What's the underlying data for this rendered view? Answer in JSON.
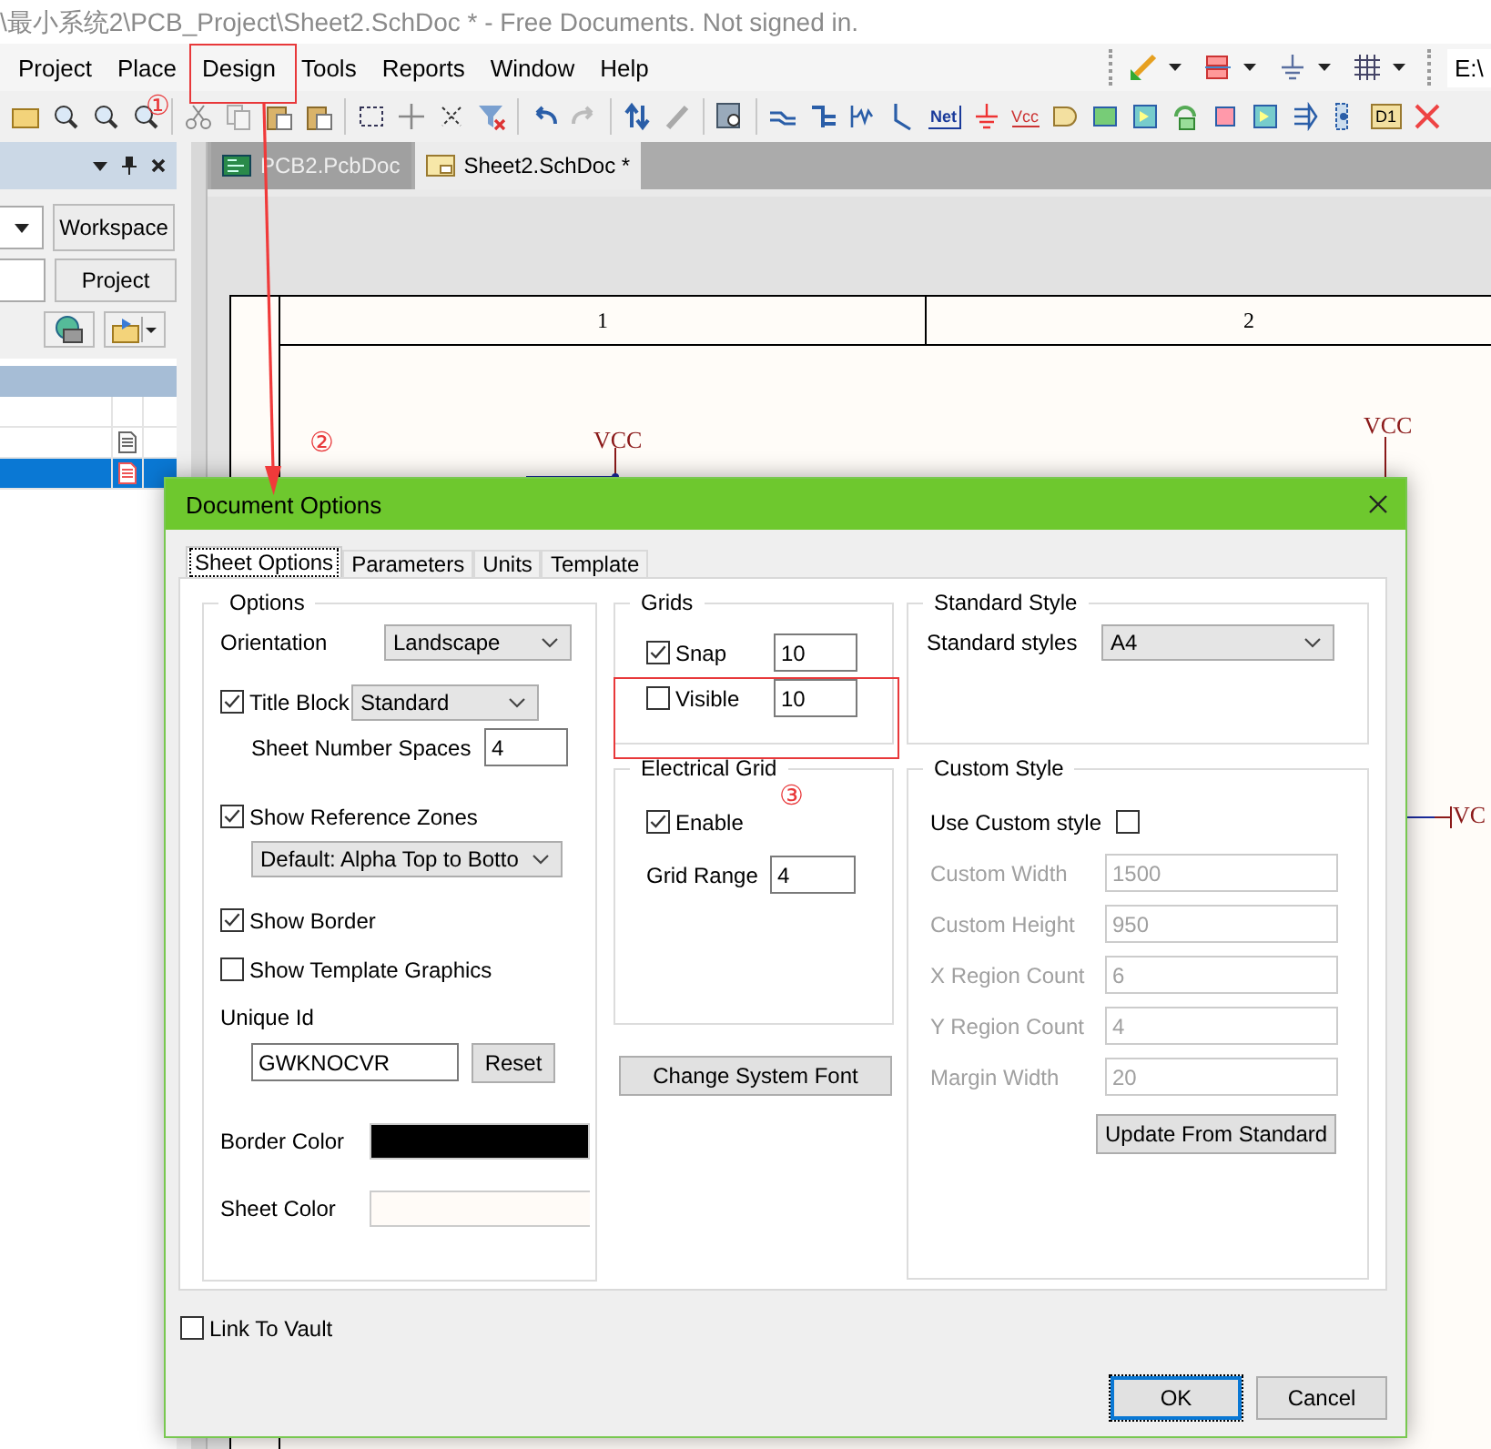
{
  "window": {
    "title": "\\最小系统2\\PCB_Project\\Sheet2.SchDoc * - Free Documents. Not signed in."
  },
  "menu": [
    "Project",
    "Place",
    "Design",
    "Tools",
    "Reports",
    "Window",
    "Help"
  ],
  "path_field": {
    "value": "E:\\"
  },
  "toolbar": {
    "net_label": "Net",
    "power_port": "Vcc",
    "part_label": "D1"
  },
  "panel": {
    "buttons": [
      "Workspace",
      "Project"
    ],
    "rows": [
      {
        "kind": "blank",
        "selected": false
      },
      {
        "kind": "document",
        "selected": false
      },
      {
        "kind": "document",
        "selected": true
      }
    ]
  },
  "doc_tabs": [
    {
      "label": "PCB2.PcbDoc",
      "kind": "pcb",
      "selected": false
    },
    {
      "label": "Sheet2.SchDoc *",
      "kind": "schematic",
      "selected": true
    }
  ],
  "sheet": {
    "zones": [
      "1",
      "2"
    ],
    "net_labels": [
      "VCC",
      "VCC",
      "VC"
    ]
  },
  "annotations": [
    {
      "kind": "circled_number",
      "label": "①"
    },
    {
      "kind": "circled_number",
      "label": "②"
    },
    {
      "kind": "circled_number",
      "label": "③"
    }
  ],
  "dialog": {
    "title": "Document Options",
    "tabs": [
      {
        "label": "Sheet Options",
        "selected": true
      },
      {
        "label": "Parameters",
        "selected": false
      },
      {
        "label": "Units",
        "selected": false
      },
      {
        "label": "Template",
        "selected": false
      }
    ],
    "options": {
      "title": "Options",
      "orientation": {
        "label": "Orientation",
        "value": "Landscape"
      },
      "title_block": {
        "label": "Title Block",
        "checked": true,
        "value": "Standard"
      },
      "sheet_number_spaces": {
        "label": "Sheet Number Spaces",
        "value": "4"
      },
      "show_reference_zones": {
        "label": "Show Reference Zones",
        "checked": true,
        "value": "Default: Alpha Top to Botto"
      },
      "show_border": {
        "label": "Show Border",
        "checked": true
      },
      "show_template_graphics": {
        "label": "Show Template Graphics",
        "checked": false
      },
      "unique_id": {
        "label": "Unique Id",
        "value": "GWKNOCVR",
        "button": "Reset"
      },
      "border_color": {
        "label": "Border Color",
        "color": "#000000"
      },
      "sheet_color": {
        "label": "Sheet Color",
        "color": "#fffbf7"
      }
    },
    "grids": {
      "title": "Grids",
      "items": [
        {
          "label": "Snap",
          "checked": true,
          "value": "10"
        },
        {
          "label": "Visible",
          "checked": false,
          "value": "10"
        }
      ]
    },
    "electrical_grid": {
      "title": "Electrical Grid",
      "enable": {
        "label": "Enable",
        "checked": true
      },
      "grid_range": {
        "label": "Grid Range",
        "value": "4"
      }
    },
    "change_font_button": "Change System Font",
    "standard_style": {
      "title": "Standard Style",
      "label": "Standard styles",
      "value": "A4"
    },
    "custom_style": {
      "title": "Custom Style",
      "use_custom": {
        "label": "Use Custom style",
        "checked": false
      },
      "fields": [
        {
          "label": "Custom Width",
          "value": "1500",
          "disabled": true
        },
        {
          "label": "Custom Height",
          "value": "950",
          "disabled": true
        },
        {
          "label": "X Region Count",
          "value": "6",
          "disabled": true
        },
        {
          "label": "Y Region Count",
          "value": "4",
          "disabled": true
        },
        {
          "label": "Margin Width",
          "value": "20",
          "disabled": true
        }
      ],
      "button": "Update From Standard"
    },
    "link_to_vault": {
      "label": "Link To Vault",
      "checked": false
    },
    "buttons": [
      {
        "label": "OK",
        "focused": true
      },
      {
        "label": "Cancel",
        "focused": false
      }
    ]
  }
}
